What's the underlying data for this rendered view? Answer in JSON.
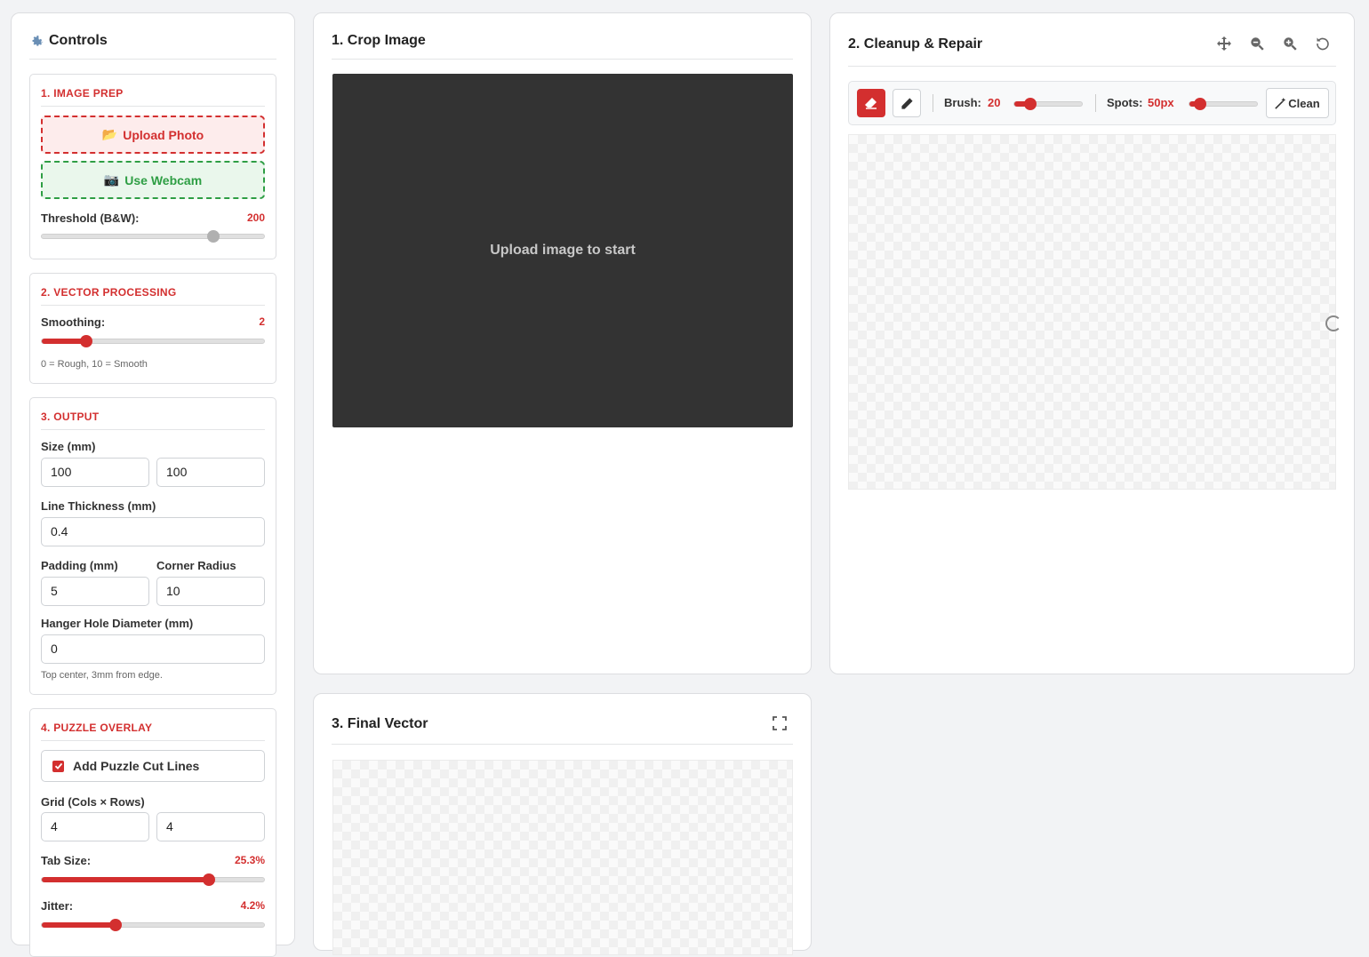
{
  "controls": {
    "title": "Controls",
    "icon": "gear-icon",
    "image_prep": {
      "title": "1. IMAGE PREP",
      "upload_label": "Upload Photo",
      "webcam_label": "Use Webcam",
      "threshold_label": "Threshold (B&W):",
      "threshold_value": "200"
    },
    "vector": {
      "title": "2. VECTOR PROCESSING",
      "smoothing_label": "Smoothing:",
      "smoothing_value": "2",
      "hint": "0 = Rough, 10 = Smooth"
    },
    "output": {
      "title": "3. OUTPUT",
      "size_label": "Size (mm)",
      "size_w": "100",
      "size_h": "100",
      "thickness_label": "Line Thickness (mm)",
      "thickness": "0.4",
      "padding_label": "Padding (mm)",
      "padding": "5",
      "radius_label": "Corner Radius",
      "radius": "10",
      "hole_label": "Hanger Hole Diameter (mm)",
      "hole": "0",
      "hint": "Top center, 3mm from edge."
    },
    "puzzle": {
      "title": "4. PUZZLE OVERLAY",
      "checkbox_label": "Add Puzzle Cut Lines",
      "checked": true,
      "grid_label": "Grid (Cols × Rows)",
      "cols": "4",
      "rows": "4",
      "tab_label": "Tab Size:",
      "tab_value": "25.3%",
      "jitter_label": "Jitter:",
      "jitter_value": "4.2%"
    }
  },
  "crop": {
    "title": "1. Crop Image",
    "placeholder": "Upload image to start"
  },
  "cleanup": {
    "title": "2. Cleanup & Repair",
    "brush_label": "Brush:",
    "brush_value": "20",
    "spots_label": "Spots:",
    "spots_value": "50px",
    "clean_label": "Clean"
  },
  "final": {
    "title": "3. Final Vector"
  },
  "slider_levels": {
    "threshold": 0.77,
    "smoothing": 0.2,
    "brush": 0.24,
    "spots": 0.16,
    "tab": 0.75,
    "jitter": 0.33
  },
  "colors": {
    "accent": "#d32f2f",
    "green": "#2e9e44",
    "dark_canvas": "#333333"
  }
}
